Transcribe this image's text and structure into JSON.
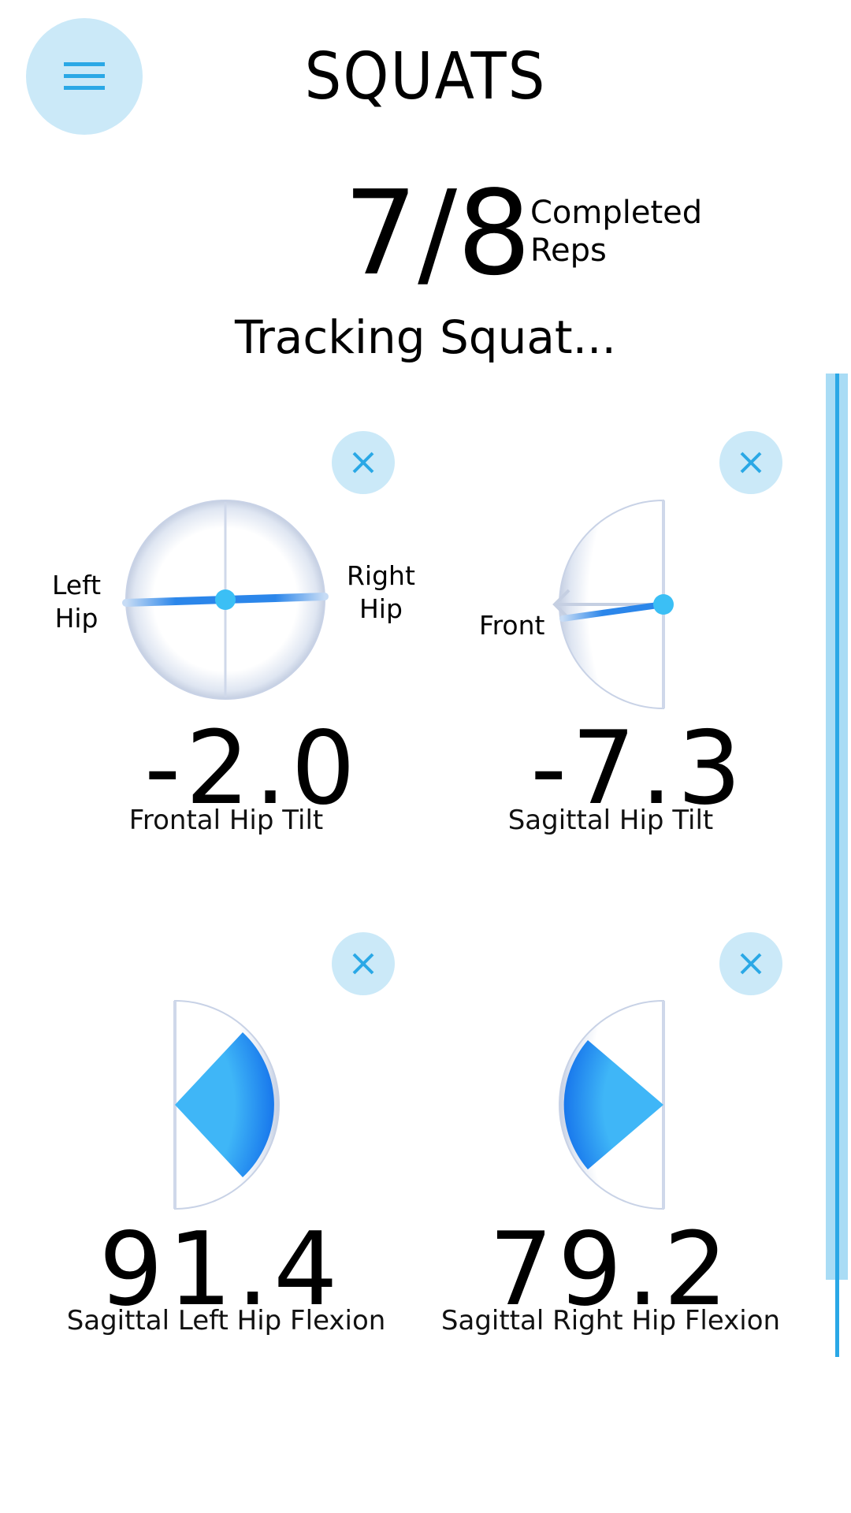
{
  "header": {
    "title": "SQUATS",
    "menu_icon": "menu-icon"
  },
  "reps": {
    "count": "7/8",
    "label_line1": "Completed",
    "label_line2": "Reps"
  },
  "status": "Tracking Squat...",
  "colors": {
    "accent": "#2aa8e6",
    "accent_light": "#cbe9f8",
    "gauge_blue": "#1e7fe8"
  },
  "metrics": {
    "frontal_hip_tilt": {
      "value": "-2.0",
      "label": "Frontal Hip Tilt",
      "left_label_1": "Left",
      "left_label_2": "Hip",
      "right_label_1": "Right",
      "right_label_2": "Hip"
    },
    "sagittal_hip_tilt": {
      "value": "-7.3",
      "label": "Sagittal Hip Tilt",
      "direction_label": "Front"
    },
    "sagittal_left_hip_flexion": {
      "value": "91.4",
      "label": "Sagittal Left Hip Flexion"
    },
    "sagittal_right_hip_flexion": {
      "value": "79.2",
      "label": "Sagittal Right Hip Flexion"
    }
  }
}
